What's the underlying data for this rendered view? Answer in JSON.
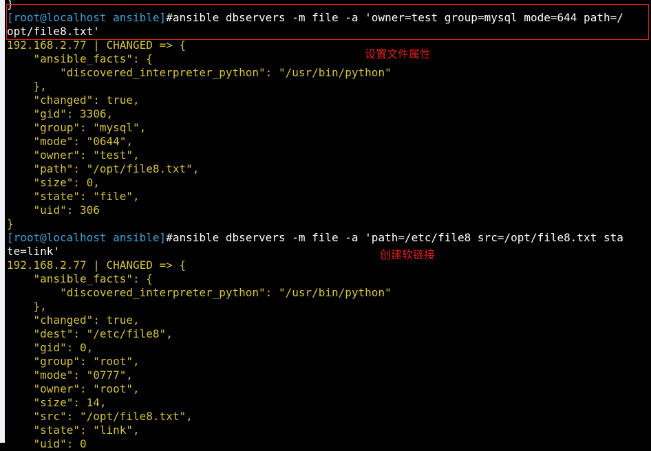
{
  "colors": {
    "prompt": "#39a4d8",
    "output": "#d6c23a",
    "annotation": "#e02020",
    "background": "#000000"
  },
  "lines": [
    {
      "t": "w",
      "text": "}"
    },
    {
      "t": "cmd",
      "prompt": "[root@localhost ansible]",
      "text": "#ansible dbservers -m file -a 'owner=test group=mysql mode=644 path=/"
    },
    {
      "t": "w",
      "text": "opt/file8.txt'"
    },
    {
      "t": "y",
      "text": "192.168.2.77 | CHANGED => {"
    },
    {
      "t": "y",
      "text": "    \"ansible_facts\": {"
    },
    {
      "t": "y",
      "text": "        \"discovered_interpreter_python\": \"/usr/bin/python\""
    },
    {
      "t": "y",
      "text": "    },"
    },
    {
      "t": "y",
      "text": "    \"changed\": true,"
    },
    {
      "t": "y",
      "text": "    \"gid\": 3306,"
    },
    {
      "t": "y",
      "text": "    \"group\": \"mysql\","
    },
    {
      "t": "y",
      "text": "    \"mode\": \"0644\","
    },
    {
      "t": "y",
      "text": "    \"owner\": \"test\","
    },
    {
      "t": "y",
      "text": "    \"path\": \"/opt/file8.txt\","
    },
    {
      "t": "y",
      "text": "    \"size\": 0,"
    },
    {
      "t": "y",
      "text": "    \"state\": \"file\","
    },
    {
      "t": "y",
      "text": "    \"uid\": 306"
    },
    {
      "t": "y",
      "text": "}"
    },
    {
      "t": "cmd",
      "prompt": "[root@localhost ansible]",
      "text": "#ansible dbservers -m file -a 'path=/etc/file8 src=/opt/file8.txt sta"
    },
    {
      "t": "w",
      "text": "te=link'"
    },
    {
      "t": "y",
      "text": "192.168.2.77 | CHANGED => {"
    },
    {
      "t": "y",
      "text": "    \"ansible_facts\": {"
    },
    {
      "t": "y",
      "text": "        \"discovered_interpreter_python\": \"/usr/bin/python\""
    },
    {
      "t": "y",
      "text": "    },"
    },
    {
      "t": "y",
      "text": "    \"changed\": true,"
    },
    {
      "t": "y",
      "text": "    \"dest\": \"/etc/file8\","
    },
    {
      "t": "y",
      "text": "    \"gid\": 0,"
    },
    {
      "t": "y",
      "text": "    \"group\": \"root\","
    },
    {
      "t": "y",
      "text": "    \"mode\": \"0777\","
    },
    {
      "t": "y",
      "text": "    \"owner\": \"root\","
    },
    {
      "t": "y",
      "text": "    \"size\": 14,"
    },
    {
      "t": "y",
      "text": "    \"src\": \"/opt/file8.txt\","
    },
    {
      "t": "y",
      "text": "    \"state\": \"link\","
    },
    {
      "t": "y",
      "text": "    \"uid\": 0"
    }
  ],
  "annotations": {
    "set_attributes": "设置文件属性",
    "create_symlink": "创建软链接"
  }
}
